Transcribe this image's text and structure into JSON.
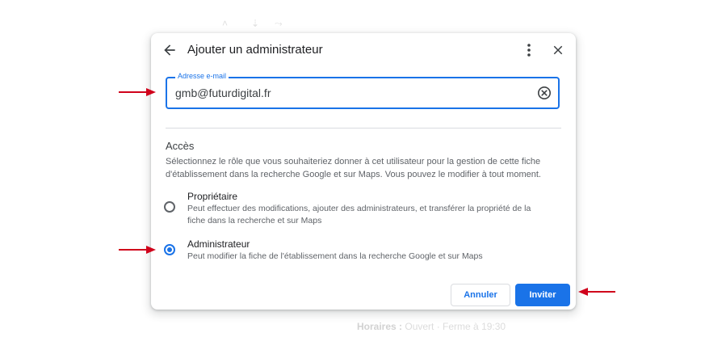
{
  "dialog": {
    "title": "Ajouter un administrateur",
    "email_field": {
      "label": "Adresse e-mail",
      "value": "gmb@futurdigital.fr"
    },
    "access": {
      "heading": "Accès",
      "description": "Sélectionnez le rôle que vous souhaiteriez donner à cet utilisateur pour la gestion de cette fiche d'établissement dans la recherche Google et sur Maps. Vous pouvez le modifier à tout moment."
    },
    "roles": [
      {
        "title": "Propriétaire",
        "description": "Peut effectuer des modifications, ajouter des administrateurs, et transférer la propriété de la fiche dans la recherche et sur Maps",
        "selected": false
      },
      {
        "title": "Administrateur",
        "description": "Peut modifier la fiche de l'établissement dans la recherche Google et sur Maps",
        "selected": true
      }
    ],
    "buttons": {
      "cancel": "Annuler",
      "invite": "Inviter"
    }
  },
  "background": {
    "hours_label": "Horaires :",
    "hours_value": "Ouvert · Ferme à 19:30"
  },
  "colors": {
    "accent": "#1a73e8",
    "annotation_arrow": "#d0021b",
    "text_secondary": "#5f6368"
  },
  "icons": {
    "back": "arrow-left-icon",
    "more": "more-vert-icon",
    "close": "close-icon",
    "clear": "clear-circle-icon",
    "annotation": "red-arrow-icon"
  }
}
